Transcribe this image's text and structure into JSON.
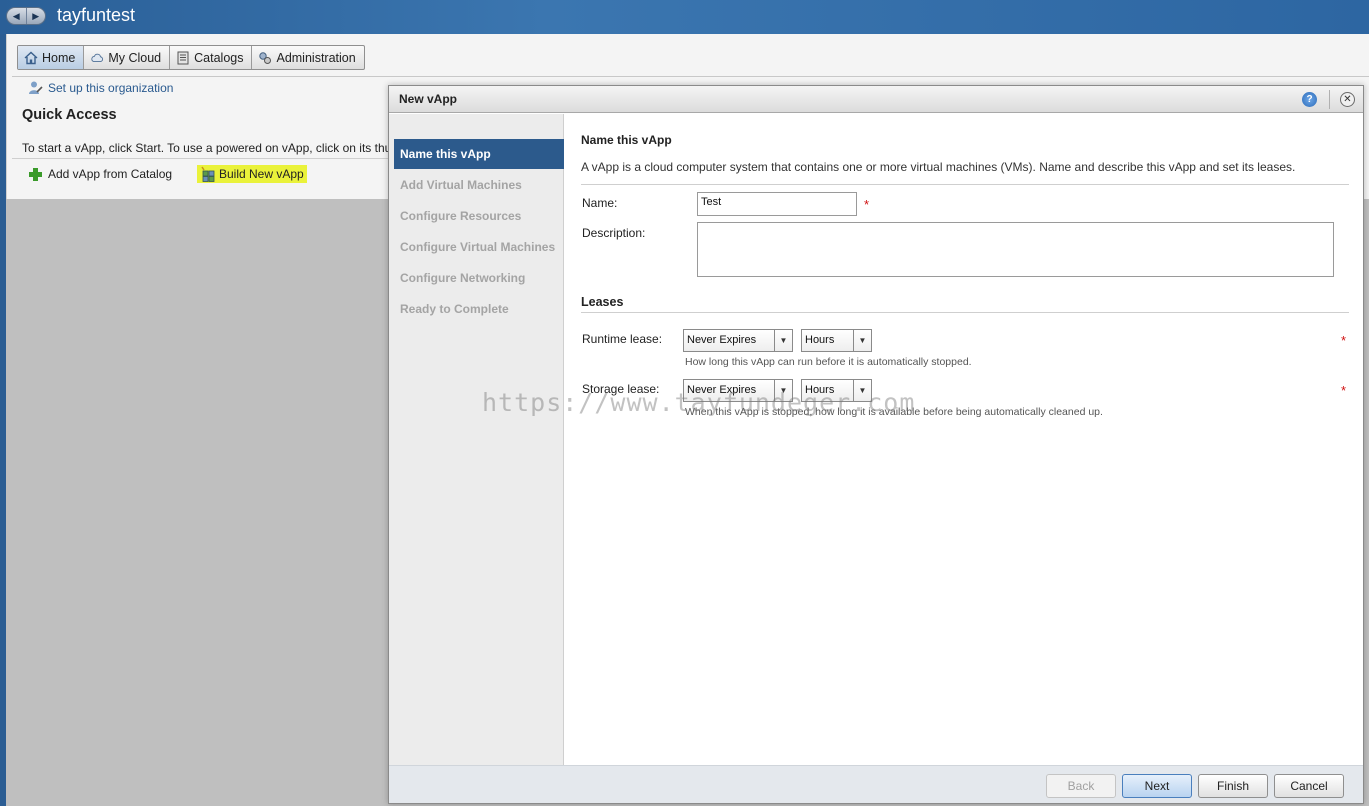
{
  "app": {
    "org_name": "tayfuntest"
  },
  "nav_tabs": [
    {
      "label": "Home",
      "icon": "home-icon",
      "active": true
    },
    {
      "label": "My Cloud",
      "icon": "cloud-icon",
      "active": false
    },
    {
      "label": "Catalogs",
      "icon": "catalog-icon",
      "active": false
    },
    {
      "label": "Administration",
      "icon": "admin-icon",
      "active": false
    }
  ],
  "home": {
    "setup_link": "Set up this organization",
    "quick_access_title": "Quick Access",
    "quick_access_text": "To start a vApp, click Start. To use a powered on vApp, click on its thu",
    "actions": {
      "add_from_catalog": "Add vApp from Catalog",
      "build_new": "Build New vApp"
    }
  },
  "dialog": {
    "title": "New vApp",
    "steps": [
      "Name this vApp",
      "Add Virtual Machines",
      "Configure Resources",
      "Configure Virtual Machines",
      "Configure Networking",
      "Ready to Complete"
    ],
    "active_step": 0,
    "section_title": "Name this vApp",
    "section_desc": "A vApp is a cloud computer system that contains one or more virtual machines (VMs). Name and describe this vApp and set its leases.",
    "name_label": "Name:",
    "name_value": "Test",
    "description_label": "Description:",
    "description_value": "",
    "leases_title": "Leases",
    "runtime_lease": {
      "label": "Runtime lease:",
      "value": "Never Expires",
      "unit": "Hours",
      "hint": "How long this vApp can run before it is automatically stopped."
    },
    "storage_lease": {
      "label": "Storage lease:",
      "value": "Never Expires",
      "unit": "Hours",
      "hint": "When this vApp is stopped, how long it is available before being automatically cleaned up."
    },
    "required_mark": "*",
    "buttons": {
      "back": "Back",
      "next": "Next",
      "finish": "Finish",
      "cancel": "Cancel"
    }
  },
  "watermark": "https://www.tayfundeger.com",
  "colors": {
    "active_step": "#2c5a8c",
    "highlight": "#eaf23a",
    "required": "#d01010",
    "topbar": "#2d66a2"
  }
}
